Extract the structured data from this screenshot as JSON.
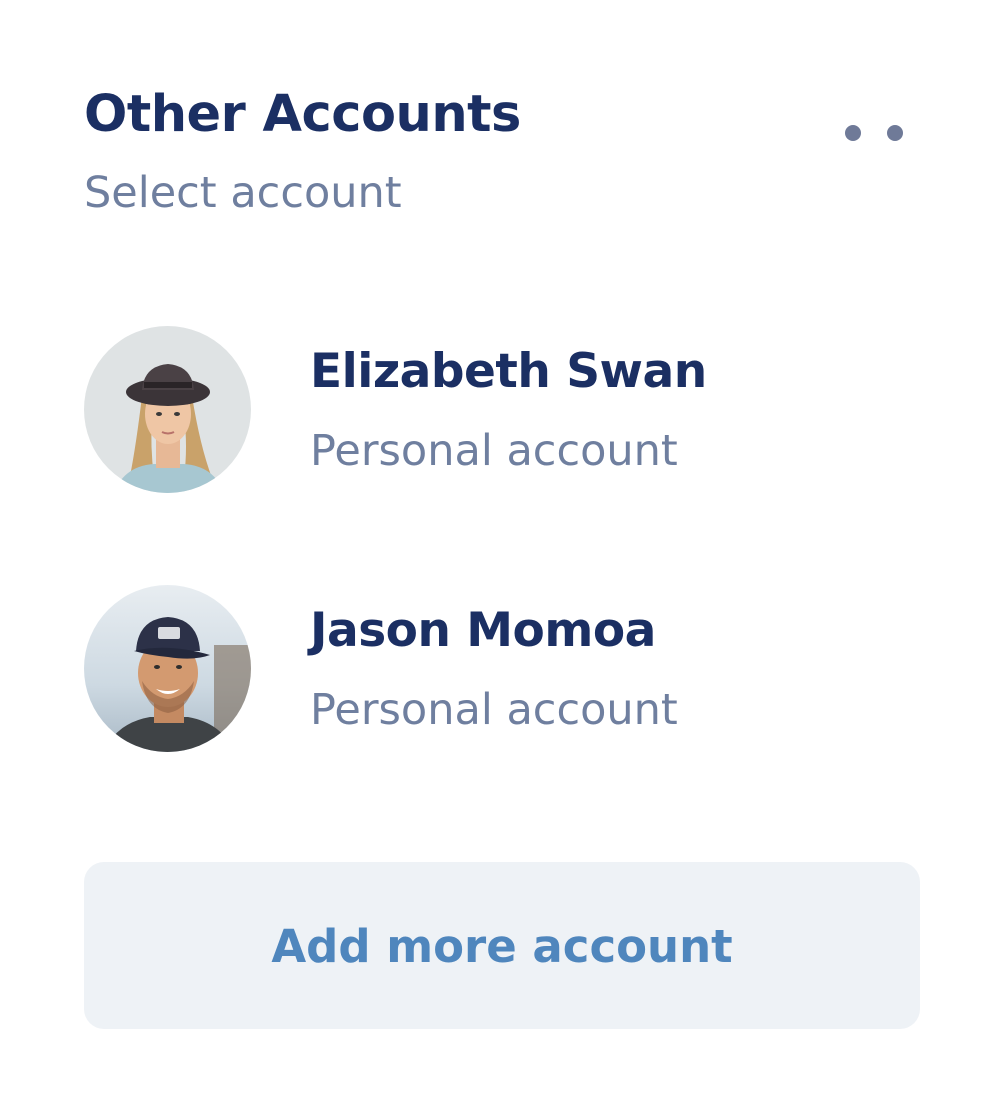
{
  "header": {
    "title": "Other Accounts",
    "subtitle": "Select account",
    "more_menu_icon": "more-dots-icon"
  },
  "accounts": [
    {
      "name": "Elizabeth Swan",
      "type": "Personal account",
      "avatar": "avatar-woman-hat"
    },
    {
      "name": "Jason Momoa",
      "type": "Personal account",
      "avatar": "avatar-man-cap"
    }
  ],
  "actions": {
    "add_label": "Add more account"
  },
  "colors": {
    "primary_text": "#1b2f63",
    "secondary_text": "#6f7f9f",
    "accent": "#4f86bd",
    "button_bg": "#eef2f6"
  }
}
